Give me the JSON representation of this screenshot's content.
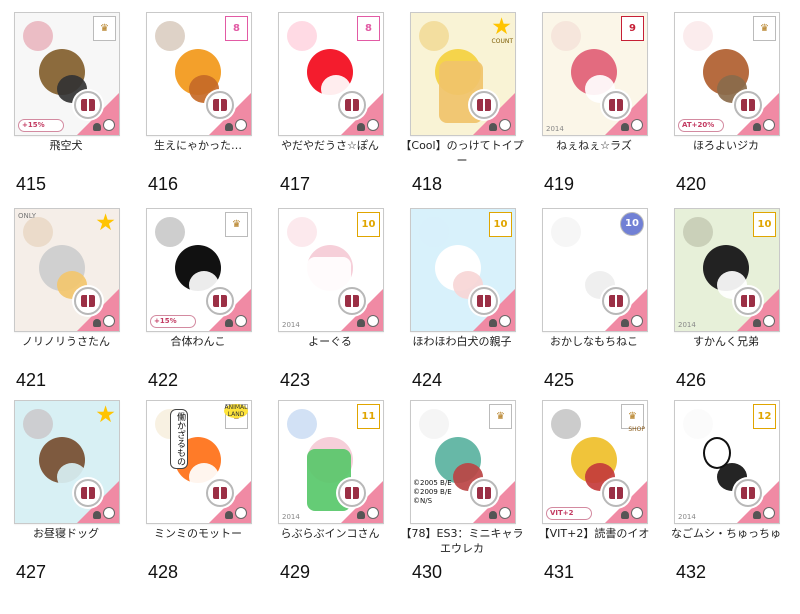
{
  "items": [
    {
      "number": "415",
      "name": "飛空犬",
      "badge": "",
      "badge_type": "box",
      "year": "",
      "bottom_label": "+15%",
      "color": "#f7f7f7"
    },
    {
      "number": "416",
      "name": "生えにゃかった…",
      "badge": "8",
      "badge_type": "box",
      "year": "",
      "bottom_label": "",
      "color": "#fff"
    },
    {
      "number": "417",
      "name": "やだやだうさ☆ぽん",
      "badge": "8",
      "badge_type": "box",
      "year": "",
      "bottom_label": "",
      "color": "#fff"
    },
    {
      "number": "418",
      "name": "【Cool】のっけてトイプー",
      "badge": "",
      "badge_type": "star",
      "year": "",
      "bottom_label": "",
      "color": "#f9f3d5"
    },
    {
      "number": "419",
      "name": "ねぇねぇ☆ラズ",
      "badge": "9",
      "badge_type": "box",
      "year": "2014",
      "bottom_label": "",
      "color": "#fbf6e8"
    },
    {
      "number": "420",
      "name": "ほろよいジカ",
      "badge": "",
      "badge_type": "box",
      "year": "",
      "bottom_label": "AT+20%",
      "color": "#fff"
    },
    {
      "number": "421",
      "name": "ノリノリうさたん",
      "badge": "",
      "badge_type": "star",
      "year": "",
      "bottom_label": "",
      "color": "#f5eee8"
    },
    {
      "number": "422",
      "name": "合体わんこ",
      "badge": "",
      "badge_type": "box",
      "year": "",
      "bottom_label": "+15%",
      "color": "#fff"
    },
    {
      "number": "423",
      "name": "よーぐる",
      "badge": "10",
      "badge_type": "box",
      "year": "2014",
      "bottom_label": "",
      "color": "#fff"
    },
    {
      "number": "424",
      "name": "ほわほわ白犬の親子",
      "badge": "10",
      "badge_type": "box",
      "year": "",
      "bottom_label": "",
      "color": "#d8f1fb"
    },
    {
      "number": "425",
      "name": "おかしなもちねこ",
      "badge": "10",
      "badge_type": "circle",
      "year": "",
      "bottom_label": "",
      "color": "#fff"
    },
    {
      "number": "426",
      "name": "すかんく兄弟",
      "badge": "10",
      "badge_type": "box",
      "year": "2014",
      "bottom_label": "",
      "color": "#e7f0d9"
    },
    {
      "number": "427",
      "name": "お昼寝ドッグ",
      "badge": "",
      "badge_type": "star",
      "year": "",
      "bottom_label": "",
      "color": "#d8f0f4"
    },
    {
      "number": "428",
      "name": "ミンミのモットー",
      "badge": "",
      "badge_type": "box",
      "year": "",
      "bottom_label": "",
      "color": "#fff"
    },
    {
      "number": "429",
      "name": "らぶらぶインコさん",
      "badge": "11",
      "badge_type": "box",
      "year": "2014",
      "bottom_label": "",
      "color": "#fff"
    },
    {
      "number": "430",
      "name": "【78】ES3：ミニキャラエウレカ",
      "badge": "",
      "badge_type": "box",
      "year": "",
      "bottom_label": "",
      "color": "#fff"
    },
    {
      "number": "431",
      "name": "【VIT+2】読書のイオ",
      "badge": "",
      "badge_type": "box",
      "year": "",
      "bottom_label": "VIT+2",
      "color": "#fff"
    },
    {
      "number": "432",
      "name": "なごムシ・ちゅっちゅ",
      "badge": "12",
      "badge_type": "box",
      "year": "2014",
      "bottom_label": "",
      "color": "#fff"
    }
  ],
  "labels": {
    "item_418_corner": "COUNT",
    "item_421_top": "ONLY",
    "item_428_logo": "ANIMAL LAND",
    "item_428_sign": "働かざるもの",
    "item_430_copyright": "©2005 B/E ©2009 B/E ©N/S",
    "item_431_corner": "SHOP"
  },
  "colors": {
    "accent_pink": "#f08aa4",
    "gift_red": "#9b2f45",
    "star_yellow": "#ffc400",
    "badge_pink": "#e25aa4",
    "badge_gold": "#e0a500",
    "badge_red": "#c61f35",
    "badge_blue": "#7180d5"
  }
}
